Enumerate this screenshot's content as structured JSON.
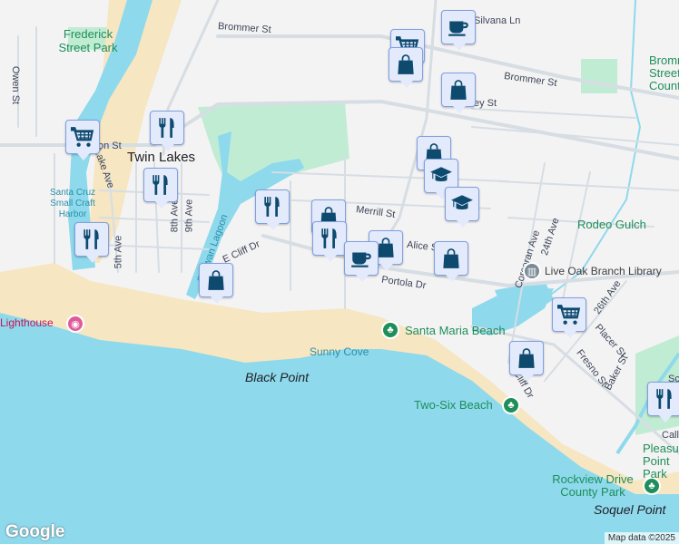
{
  "colors": {
    "land": "#f4f3f4",
    "water": "#8ed9ec",
    "beach": "#f6e6c2",
    "park": "#c1ecd4",
    "marker": "#0d4a6e"
  },
  "streets": [
    "Brommer St",
    "Brommer St",
    "Owen St",
    "Lake Ave",
    "5th Ave",
    "8th Ave",
    "9th Ave",
    "E Cliff Dr",
    "Merrill St",
    "Alice St",
    "Portola Dr",
    "Corcoran Ave",
    "24th Ave",
    "26th Ave",
    "Placer St",
    "Fresno St",
    "Baker St",
    "Silvana Ln",
    "Cliff Dr",
    "on St",
    "ey St"
  ],
  "places": {
    "twin_lakes": "Twin Lakes",
    "frederick": "Frederick Street Park",
    "harbor": "Santa Cruz Small Craft Harbor",
    "lagoon": "Schwan Lagoon",
    "lighthouse": "Lighthouse",
    "sunny_cove": "Sunny Cove",
    "black_point": "Black Point",
    "santa_maria": "Santa Maria Beach",
    "two_six": "Two-Six Beach",
    "rodeo": "Rodeo Gulch",
    "library": "Live Oak Branch Library",
    "brommer_park": "Brommer Street County",
    "rockview": "Rockview Drive County Park",
    "pleasure": "Pleasure Point Park",
    "soquel": "Soquel Point",
    "call": "Call",
    "sc": "Sc"
  },
  "markers": [
    "grocery-icon",
    "restaurant-icon",
    "restaurant-icon",
    "restaurant-icon",
    "restaurant-icon",
    "shopping-bag-icon",
    "grocery-icon",
    "shopping-bag-icon",
    "coffee-icon",
    "shopping-bag-icon",
    "shopping-bag-icon",
    "school-icon",
    "school-icon",
    "shopping-bag-icon",
    "restaurant-icon",
    "shopping-bag-icon",
    "coffee-icon",
    "shopping-bag-icon",
    "grocery-icon",
    "shopping-bag-icon",
    "restaurant-icon"
  ],
  "attribution": "Map data ©2025",
  "logo": "Google"
}
